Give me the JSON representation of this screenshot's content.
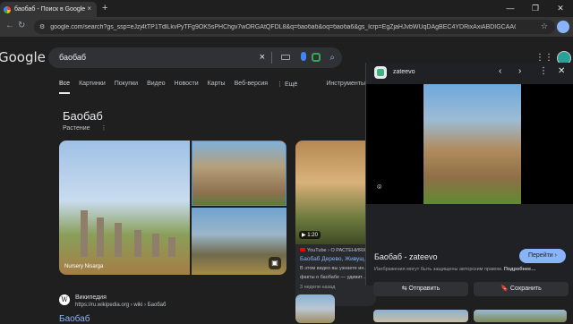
{
  "browser": {
    "tab_title": "баобаб - Поиск в Google",
    "tab_close": "×",
    "new_tab": "+",
    "url": "google.com/search?gs_ssp=eJzj4tTP1TdlLkvPyTFg9OK5sPHChgv7wORGAtQFDL8&q=баобаб&oq=баоба6&gs_lcrp=EgZjaHJvbWUqDAgBEC4YDRixAxiABDIGCAAQRRg5MgwIARAuGA0...",
    "star": "☆",
    "window_controls": [
      "—",
      "❐",
      "✕"
    ]
  },
  "google": {
    "logo": "Google",
    "query": "баобаб",
    "tabs": [
      "Все",
      "Картинки",
      "Покупки",
      "Видео",
      "Новости",
      "Карты",
      "Веб-версия",
      "⋮ Ещё"
    ],
    "tools": "Инструменты"
  },
  "knowledge": {
    "title": "Баобаб",
    "subtitle": "Растение",
    "dots": "⋮",
    "image_caption": "Nursery Nisarga"
  },
  "video": {
    "duration": "▶ 1:20",
    "source": "YouTube › О РАСТЕНИЯХ",
    "title": "Баобаб Дерево, Живущ… Лет 🌳",
    "desc_1": "В этом видео вы узнаете ин…",
    "desc_2": "факты о баобабе — удивит…",
    "date": "3 недели назад"
  },
  "wiki": {
    "logo": "W",
    "name": "Википедия",
    "url": "https://ru.wikipedia.org › wiki › Баобаб",
    "title": "Баобаб"
  },
  "panel": {
    "site": "zateevo",
    "prev": "‹",
    "next": "›",
    "more": "⋮",
    "close": "✕",
    "title": "Баобаб - zateevo",
    "visit": "Перейти ›",
    "note": "Изображения могут быть защищены авторским правом.",
    "note_more": "Подробнее…",
    "share": "⇆ Отправить",
    "save": "🔖 Сохранить"
  }
}
